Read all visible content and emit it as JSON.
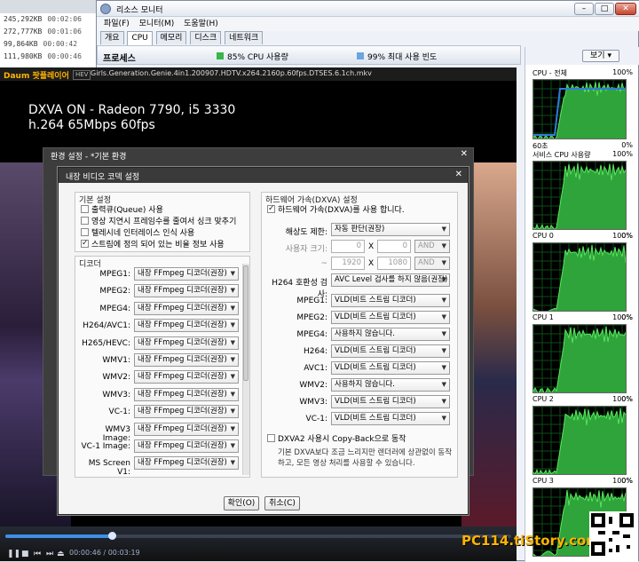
{
  "filelist": [
    {
      "size": "245,292KB",
      "time": "00:02:06"
    },
    {
      "size": "272,777KB",
      "time": "00:01:06"
    },
    {
      "size": "99,864KB",
      "time": "00:00:42"
    },
    {
      "size": "111,980KB",
      "time": "00:00:46"
    }
  ],
  "resmon": {
    "title": "리소스 모니터",
    "menu": [
      "파일(F)",
      "모니터(M)",
      "도움말(H)"
    ],
    "tabs": [
      "개요",
      "CPU",
      "메모리",
      "디스크",
      "네트워크"
    ],
    "active_tab": "CPU",
    "process_label": "프로세스",
    "cpu_usage": "85% CPU 사용량",
    "max_freq": "99% 최대 사용 빈도",
    "view_button": "보기",
    "graphs": [
      {
        "label": "CPU - 전체",
        "pct": "100%",
        "bottom": "0%",
        "foot": "60초",
        "color": "#2f7bd9"
      },
      {
        "label": "서비스 CPU 사용량",
        "pct": "100%",
        "bottom": "0%",
        "foot": ""
      },
      {
        "label": "CPU 0",
        "pct": "100%",
        "bottom": "0%",
        "foot": ""
      },
      {
        "label": "CPU 1",
        "pct": "100%",
        "bottom": "0%",
        "foot": ""
      },
      {
        "label": "CPU 2",
        "pct": "100%",
        "bottom": "0%",
        "foot": ""
      },
      {
        "label": "CPU 3",
        "pct": "100%",
        "bottom": "",
        "foot": ""
      }
    ]
  },
  "player": {
    "logo": "Daum 팟플레이어",
    "badge": "HEV",
    "filename": "Girls.Generation.Genie.4in1.200907.HDTV.x264.2160p.60fps.DTSES.6.1ch.mkv",
    "osd_line1": "DXVA ON - Radeon 7790, i5 3330",
    "osd_line2": "h.264 65Mbps 60fps",
    "time_current": "00:00:46",
    "time_total": "00:03:19",
    "progress": 0.21
  },
  "env": {
    "title": "환경 설정 - *기본 환경"
  },
  "codec": {
    "title": "내장 비디오 코덱 설정",
    "basic_title": "기본 설정",
    "basic": [
      {
        "label": "출력큐(Queue) 사용",
        "checked": false
      },
      {
        "label": "영상 지연시 프레임수를 줄여서 싱크 맞추기",
        "checked": false
      },
      {
        "label": "텔레시네 인터레이스 인식 사용",
        "checked": false
      },
      {
        "label": "스트림에 정의 되어 있는 비율 정보 사용",
        "checked": true
      }
    ],
    "decoder_title": "디코더",
    "decoders": [
      {
        "name": "MPEG1:",
        "value": "내장 FFmpeg 디코더(권장)"
      },
      {
        "name": "MPEG2:",
        "value": "내장 FFmpeg 디코더(권장)"
      },
      {
        "name": "MPEG4:",
        "value": "내장 FFmpeg 디코더(권장)"
      },
      {
        "name": "H264/AVC1:",
        "value": "내장 FFmpeg 디코더(권장)"
      },
      {
        "name": "H265/HEVC:",
        "value": "내장 FFmpeg 디코더(권장)"
      },
      {
        "name": "WMV1:",
        "value": "내장 FFmpeg 디코더(권장)"
      },
      {
        "name": "WMV2:",
        "value": "내장 FFmpeg 디코더(권장)"
      },
      {
        "name": "WMV3:",
        "value": "내장 FFmpeg 디코더(권장)"
      },
      {
        "name": "VC-1:",
        "value": "내장 FFmpeg 디코더(권장)"
      },
      {
        "name": "WMV3 Image:",
        "value": "내장 FFmpeg 디코더(권장)"
      },
      {
        "name": "VC-1 Image:",
        "value": "내장 FFmpeg 디코더(권장)"
      },
      {
        "name": "MS Screen V1:",
        "value": "내장 FFmpeg 디코더(권장)"
      }
    ],
    "hw_title": "하드웨어 가속(DXVA) 설정",
    "hw_enable": "하드웨어 가속(DXVA)를 사용 합니다.",
    "res_limit_label": "해상도 제한:",
    "res_limit_value": "자동 판단(권장)",
    "user_size_label": "사용자 크기:",
    "user_w": "0",
    "user_h": "0",
    "and1": "AND",
    "max_w": "1920",
    "max_h": "1080",
    "and2": "AND",
    "x_sep": "X",
    "tilde": "~",
    "h264_check_label": "H264 호환성 검사:",
    "h264_check_value": "AVC Level 검사를 하지 않음(권장)",
    "hw_decoders": [
      {
        "name": "MPEG1:",
        "value": "VLD(비트 스트림 디코더)"
      },
      {
        "name": "MPEG2:",
        "value": "VLD(비트 스트림 디코더)"
      },
      {
        "name": "MPEG4:",
        "value": "사용하지 않습니다."
      },
      {
        "name": "H264:",
        "value": "VLD(비트 스트림 디코더)"
      },
      {
        "name": "AVC1:",
        "value": "VLD(비트 스트림 디코더)"
      },
      {
        "name": "WMV2:",
        "value": "사용하지 않습니다."
      },
      {
        "name": "WMV3:",
        "value": "VLD(비트 스트림 디코더)"
      },
      {
        "name": "VC-1:",
        "value": "VLD(비트 스트림 디코더)"
      }
    ],
    "copyback_label": "DXVA2 사용시 Copy-Back으로 동작",
    "copyback_desc1": "기본 DXVA보다 조금 느리지만 렌더러에 상관없이 동작",
    "copyback_desc2": "하고, 모든 영상 처리를 사용할 수 있습니다.",
    "ok": "확인(O)",
    "cancel": "취소(C)"
  },
  "watermark": "PC114.tiStory.com"
}
